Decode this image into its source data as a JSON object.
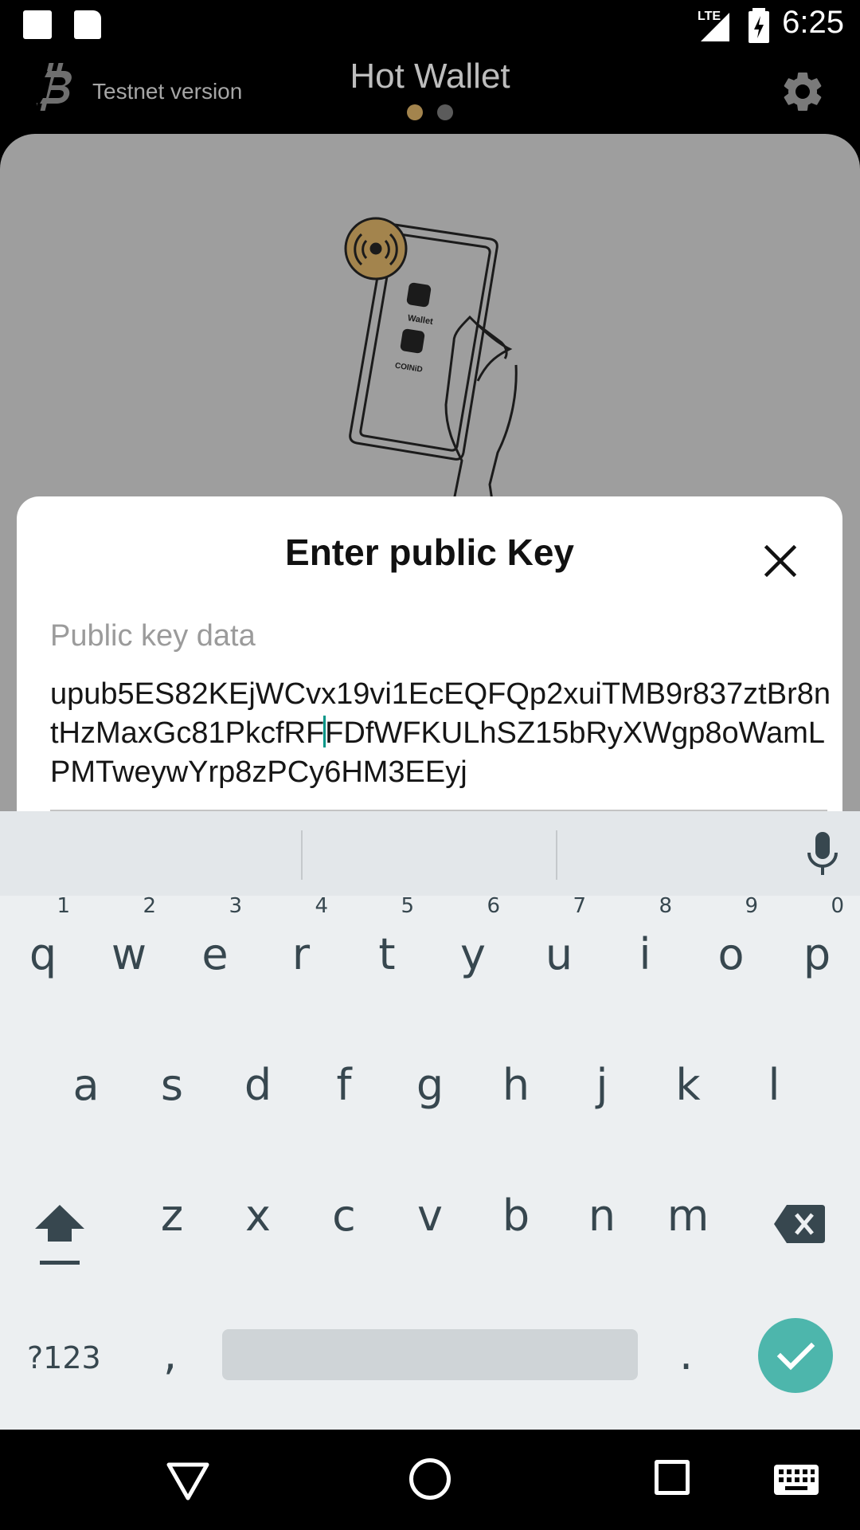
{
  "status_bar": {
    "time": "6:25",
    "network": "LTE"
  },
  "header": {
    "subtitle": "Testnet version",
    "title": "Hot Wallet",
    "icons": {
      "logo": "bitcoin-icon",
      "settings": "gear-icon"
    }
  },
  "illustration": {
    "button_wallet": "Wallet",
    "button_coinid": "COINiD"
  },
  "dialog": {
    "title": "Enter public Key",
    "field_label": "Public key data",
    "key_before_cursor": "upub5ES82KEjWCvx19vi1EcEQFQp2xuiTMB9r837ztBr8ntHzMaxGc81PkcfRF",
    "key_after_cursor": "FDfWFKULhSZ15bRyXWgp8oWamLPMTweywYrp8zPCy6HM3EEyj"
  },
  "keyboard": {
    "row1": [
      {
        "key": "q",
        "hint": "1"
      },
      {
        "key": "w",
        "hint": "2"
      },
      {
        "key": "e",
        "hint": "3"
      },
      {
        "key": "r",
        "hint": "4"
      },
      {
        "key": "t",
        "hint": "5"
      },
      {
        "key": "y",
        "hint": "6"
      },
      {
        "key": "u",
        "hint": "7"
      },
      {
        "key": "i",
        "hint": "8"
      },
      {
        "key": "o",
        "hint": "9"
      },
      {
        "key": "p",
        "hint": "0"
      }
    ],
    "row2": [
      "a",
      "s",
      "d",
      "f",
      "g",
      "h",
      "j",
      "k",
      "l"
    ],
    "row3": [
      "z",
      "x",
      "c",
      "v",
      "b",
      "n",
      "m"
    ],
    "symbols": "?123",
    "comma": ",",
    "period": "."
  },
  "colors": {
    "accent": "#a3844d",
    "keyboard_enter": "#4db6ac",
    "cursor": "#009688"
  }
}
